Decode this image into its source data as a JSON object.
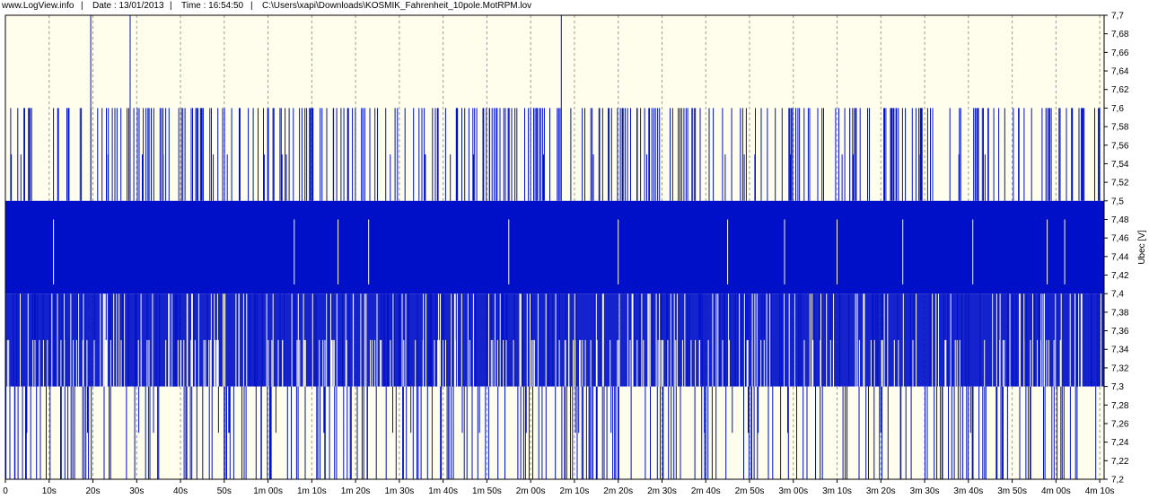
{
  "header": {
    "site": "www.LogView.info",
    "sep": "|",
    "date_label": "Date : 13/01/2013",
    "time_label": "Time : 16:54:50",
    "file_path": "C:\\Users\\xapi\\Downloads\\KOSMIK_Fahrenheit_10pole.MotRPM.lov"
  },
  "colors": {
    "plot_bg": "#fffdeb",
    "series": "#0010c8",
    "grid": "#9a9a9a",
    "axis": "#000000"
  },
  "chart_data": {
    "type": "line",
    "title": "",
    "xlabel": "",
    "ylabel": "Ubec [V]",
    "ylim": [
      7.2,
      7.7
    ],
    "xlim": [
      0,
      251
    ],
    "x_unit": "s",
    "grid": true,
    "y_ticks": [
      "7,2",
      "7,22",
      "7,24",
      "7,26",
      "7,28",
      "7,3",
      "7,32",
      "7,34",
      "7,36",
      "7,38",
      "7,4",
      "7,42",
      "7,44",
      "7,46",
      "7,48",
      "7,5",
      "7,52",
      "7,54",
      "7,56",
      "7,58",
      "7,6",
      "7,62",
      "7,64",
      "7,66",
      "7,68",
      "7,7"
    ],
    "x_ticks": [
      {
        "value": 0,
        "label": "0"
      },
      {
        "value": 10,
        "label": "10s"
      },
      {
        "value": 20,
        "label": "20s"
      },
      {
        "value": 30,
        "label": "30s"
      },
      {
        "value": 40,
        "label": "40s"
      },
      {
        "value": 50,
        "label": "50s"
      },
      {
        "value": 60,
        "label": "1m 00s"
      },
      {
        "value": 70,
        "label": "1m 10s"
      },
      {
        "value": 80,
        "label": "1m 20s"
      },
      {
        "value": 90,
        "label": "1m 30s"
      },
      {
        "value": 100,
        "label": "1m 40s"
      },
      {
        "value": 110,
        "label": "1m 50s"
      },
      {
        "value": 120,
        "label": "2m 00s"
      },
      {
        "value": 130,
        "label": "2m 10s"
      },
      {
        "value": 140,
        "label": "2m 20s"
      },
      {
        "value": 150,
        "label": "2m 30s"
      },
      {
        "value": 160,
        "label": "2m 40s"
      },
      {
        "value": 170,
        "label": "2m 50s"
      },
      {
        "value": 180,
        "label": "3m 00s"
      },
      {
        "value": 190,
        "label": "3m 10s"
      },
      {
        "value": 200,
        "label": "3m 20s"
      },
      {
        "value": 210,
        "label": "3m 30s"
      },
      {
        "value": 220,
        "label": "3m 40s"
      },
      {
        "value": 230,
        "label": "3m 50s"
      },
      {
        "value": 240,
        "label": "4m 00s"
      },
      {
        "value": 250,
        "label": "4m 10s"
      }
    ],
    "series": [
      {
        "values_summary": {
          "band_low": 7.4,
          "band_high": 7.5,
          "secondary_low": 7.3,
          "secondary_high": 7.4,
          "spike_values": [
            7.6,
            7.55,
            7.7
          ],
          "dip_values": [
            7.2,
            7.25
          ],
          "levels": [
            7.2,
            7.25,
            7.3,
            7.35,
            7.4,
            7.45,
            7.5,
            7.55,
            7.6,
            7.7
          ]
        }
      }
    ]
  }
}
